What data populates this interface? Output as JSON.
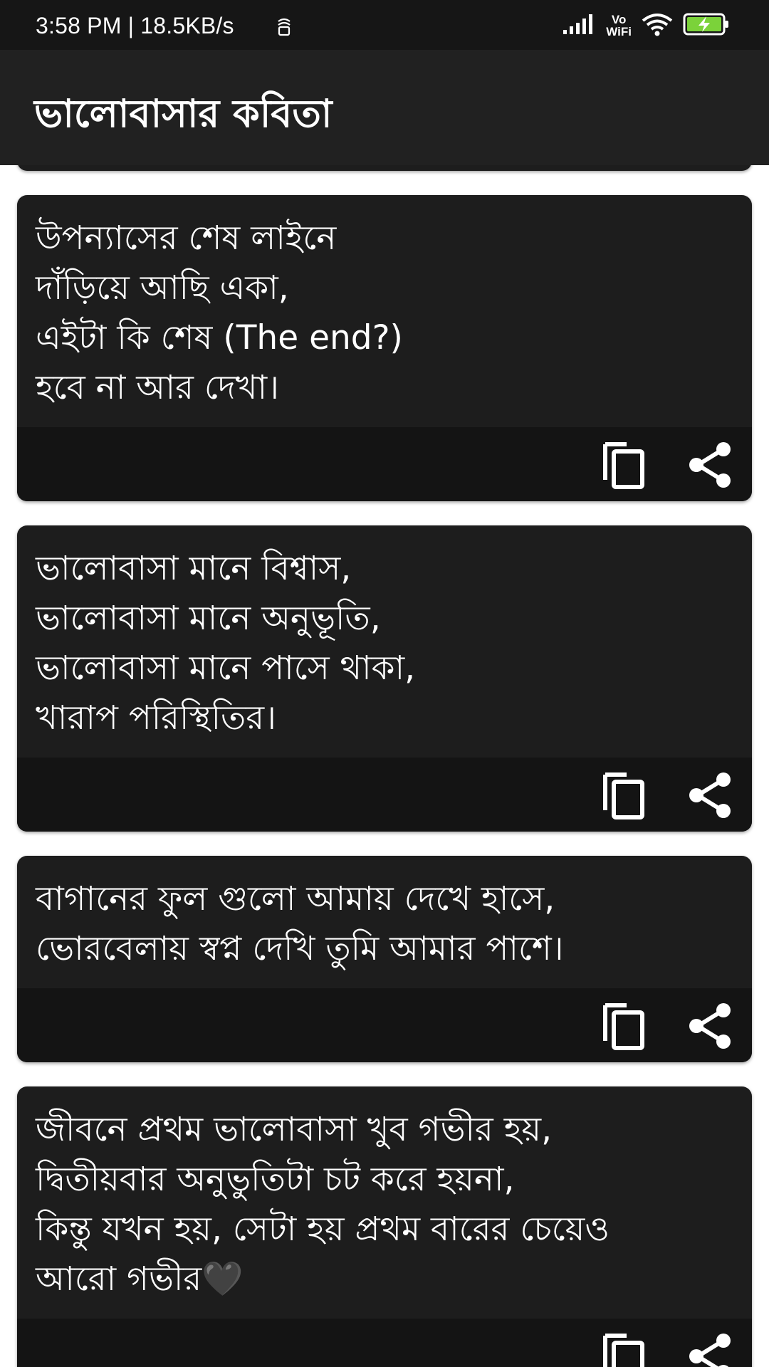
{
  "status_bar": {
    "time_speed": "3:58 PM | 18.5KB/s",
    "network_label_top": "Vo",
    "network_label_bottom": "WiFi",
    "icons": [
      "notification-icon",
      "signal-icon",
      "vowifi-icon",
      "wifi-icon",
      "battery-charging-icon"
    ]
  },
  "app_bar": {
    "title": "ভালোবাসার কবিতা"
  },
  "cards": [
    {
      "text": "উপন্যাসের শেষ লাইনে\nদাঁড়িয়ে আছি একা,\nএইটা কি শেষ (The end?)\nহবে না আর দেখা।",
      "copy_icon": "copy-icon",
      "share_icon": "share-icon"
    },
    {
      "text": "ভালোবাসা মানে বিশ্বাস,\nভালোবাসা মানে অনুভূতি,\nভালোবাসা মানে পাসে থাকা,\nখারাপ পরিস্থিতির।",
      "copy_icon": "copy-icon",
      "share_icon": "share-icon"
    },
    {
      "text": "বাগানের ফুল গুলো আমায় দেখে হাসে,\nভোরবেলায় স্বপ্ন দেখি তুমি আমার পাশে।",
      "copy_icon": "copy-icon",
      "share_icon": "share-icon"
    },
    {
      "text": "জীবনে প্রথম ভালোবাসা খুব গভীর হয়,\nদ্বিতীয়বার অনুভুতিটা চট করে হয়না,\nকিন্তু যখন হয়, সেটা হয় প্রথম বারের চেয়েও\nআরো গভীর🖤",
      "copy_icon": "copy-icon",
      "share_icon": "share-icon"
    }
  ],
  "colors": {
    "status_bar": "#161616",
    "app_bar": "#212121",
    "card": "#1d1d1d",
    "card_actions": "#141414",
    "battery_charge": "#7bd23a",
    "text": "#ffffff"
  }
}
